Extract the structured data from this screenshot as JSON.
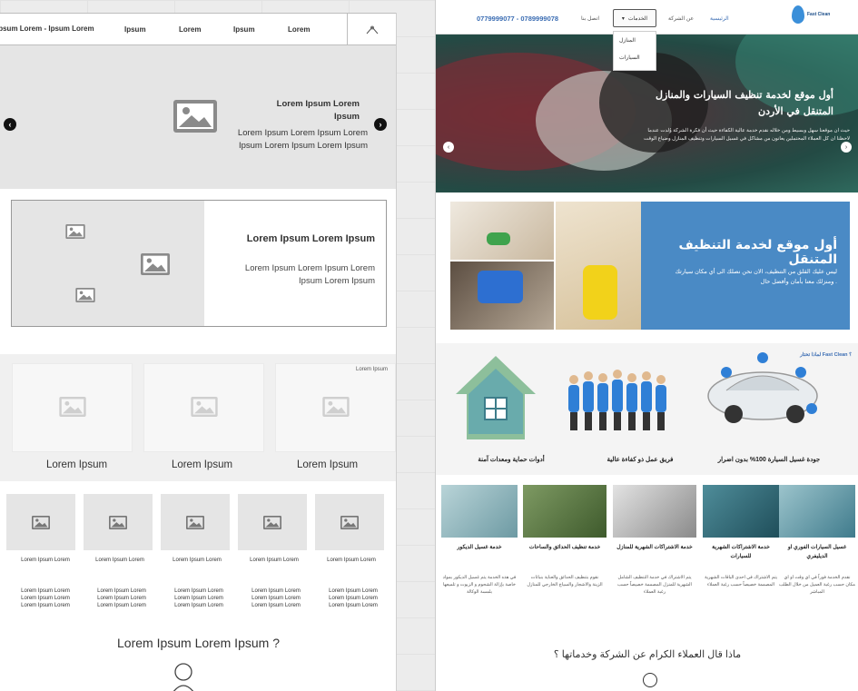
{
  "wireframe": {
    "nav": {
      "brand": "Ipsum Lorem - Ipsum Lorem",
      "links": [
        "Ipsum",
        "Lorem",
        "Ipsum",
        "Lorem"
      ]
    },
    "hero": {
      "title": "Lorem Ipsum Lorem Ipsum",
      "text": "Lorem Ipsum Lorem Ipsum Lorem Ipsum Lorem Ipsum Lorem Ipsum"
    },
    "feature": {
      "title": "Lorem Ipsum Lorem Ipsum",
      "text": "Lorem Ipsum Lorem Ipsum Lorem Ipsum Lorem Ipsum"
    },
    "cards": {
      "tag": "Lorem Ipsum",
      "labels": [
        "Lorem Ipsum",
        "Lorem Ipsum",
        "Lorem Ipsum"
      ]
    },
    "services": {
      "captions": [
        "Lorem Ipsum Lorem",
        "Lorem Ipsum Lorem",
        "Lorem Ipsum Lorem",
        "Lorem Ipsum Lorem",
        "Lorem Ipsum Lorem"
      ],
      "texts": [
        "Lorem Ipsum Lorem Lorem Ipsum Lorem Lorem Ipsum Lorem",
        "Lorem Ipsum Lorem Lorem Ipsum Lorem Lorem Ipsum Lorem",
        "Lorem Ipsum Lorem Lorem Ipsum Lorem Lorem Ipsum Lorem",
        "Lorem Ipsum Lorem Lorem Ipsum Lorem Lorem Ipsum Lorem",
        "Lorem Ipsum Lorem Lorem Ipsum Lorem Lorem Ipsum Lorem"
      ]
    },
    "question": "Lorem Ipsum Lorem Ipsum ?"
  },
  "site": {
    "nav": {
      "phone": "0779999077 - 0789999078",
      "contact": "اتصل بنا",
      "services": "الخدمات",
      "about": "عن الشركة",
      "home": "الرئيسية",
      "dropdown": [
        "المنازل",
        "السيارات"
      ],
      "logo": "Fast Clean"
    },
    "hero": {
      "title": "أول موقع لخدمة تنظيف السيارات والمنازل المتنقل في الأردن",
      "text": "حيث ان موقعنا سهل وبسيط ومن خلاله نقدم خدمة عالية الكفاءة حيث أن فكرة الشركة وُلدت عندما لاحظنا ان كل العملاء المحتملين يعانون من مشاكل في غسيل السيارات وتنظيف المنازل وضياع الوقت"
    },
    "feature": {
      "title": "أول موقع لخدمة التنظيف المتنقل",
      "text": "ليس عليك القلق من التنظيف، الان نحن نصلك الى أي مكان سيارتك ومنزلك معنا بأمان وأفضل حال ."
    },
    "features": {
      "tag": "لماذا تختار Fast Clean ؟",
      "labels": [
        "جودة غسيل السيارة 100% بدون اضرار",
        "فريق عمل ذو كفاءة عالية",
        "أدوات حماية ومعدات آمنة"
      ]
    },
    "services": [
      {
        "title": "غسيل السيارات الفوري او الديليفري",
        "desc": "نقدم الخدمة فوراً في اي وقت او اي مكان حسب رغبة العميل من خلال الطلب المباشر"
      },
      {
        "title": "خدمة الاشتراكات الشهرية للسيارات",
        "desc": "يتم الاشتراك في احدى الباقات الشهرية المصممة خصيصاً حسب رغبة العملاء"
      },
      {
        "title": "خدمة الاشتراكات الشهرية للمنازل",
        "desc": "يتم الاشتراك في خدمة التنظيف الشامل الشهرية للمنزل المصممة خصيصاً حسب رغبة العملاء"
      },
      {
        "title": "خدمة تنظيف الحدائق والساحات",
        "desc": "نقوم بتنظيف الحدائق والعناية بنباتات الزينة والاشجار والسياج الخارجي للمنازل"
      },
      {
        "title": "خدمة غسيل الديكور",
        "desc": "في هذه الخدمة يتم غسيل الديكور بمواد خاصة بإزالة الشحوم و الزيوت و تلميعها بلمسة الوكالة"
      }
    ],
    "question": "ماذا قال العملاء الكرام عن الشركة وخدماتها ؟"
  },
  "colors": {
    "accent_blue": "#4a8ac5",
    "phone_blue": "#3b6db3",
    "wire_gray": "#e5e5e5"
  }
}
